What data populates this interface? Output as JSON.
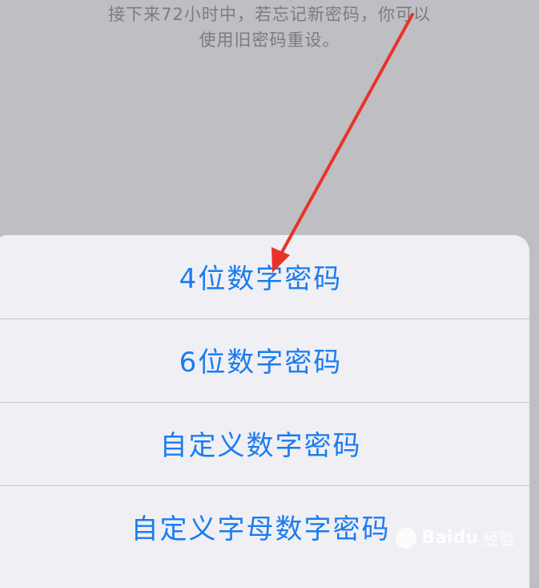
{
  "info": {
    "line1": "接下来72小时中，若忘记新密码，你可以",
    "line2": "使用旧密码重设。"
  },
  "action_sheet": {
    "options": [
      {
        "label": "4位数字密码"
      },
      {
        "label": "6位数字密码"
      },
      {
        "label": "自定义数字密码"
      },
      {
        "label": "自定义字母数字密码"
      }
    ]
  },
  "annotation": {
    "arrow_color": "#e8332a"
  },
  "watermark": {
    "brand": "Baidu",
    "suffix": "经验"
  },
  "colors": {
    "accent": "#1a7cf0",
    "backdrop": "#bfbec3",
    "sheet": "#f0eff4"
  }
}
